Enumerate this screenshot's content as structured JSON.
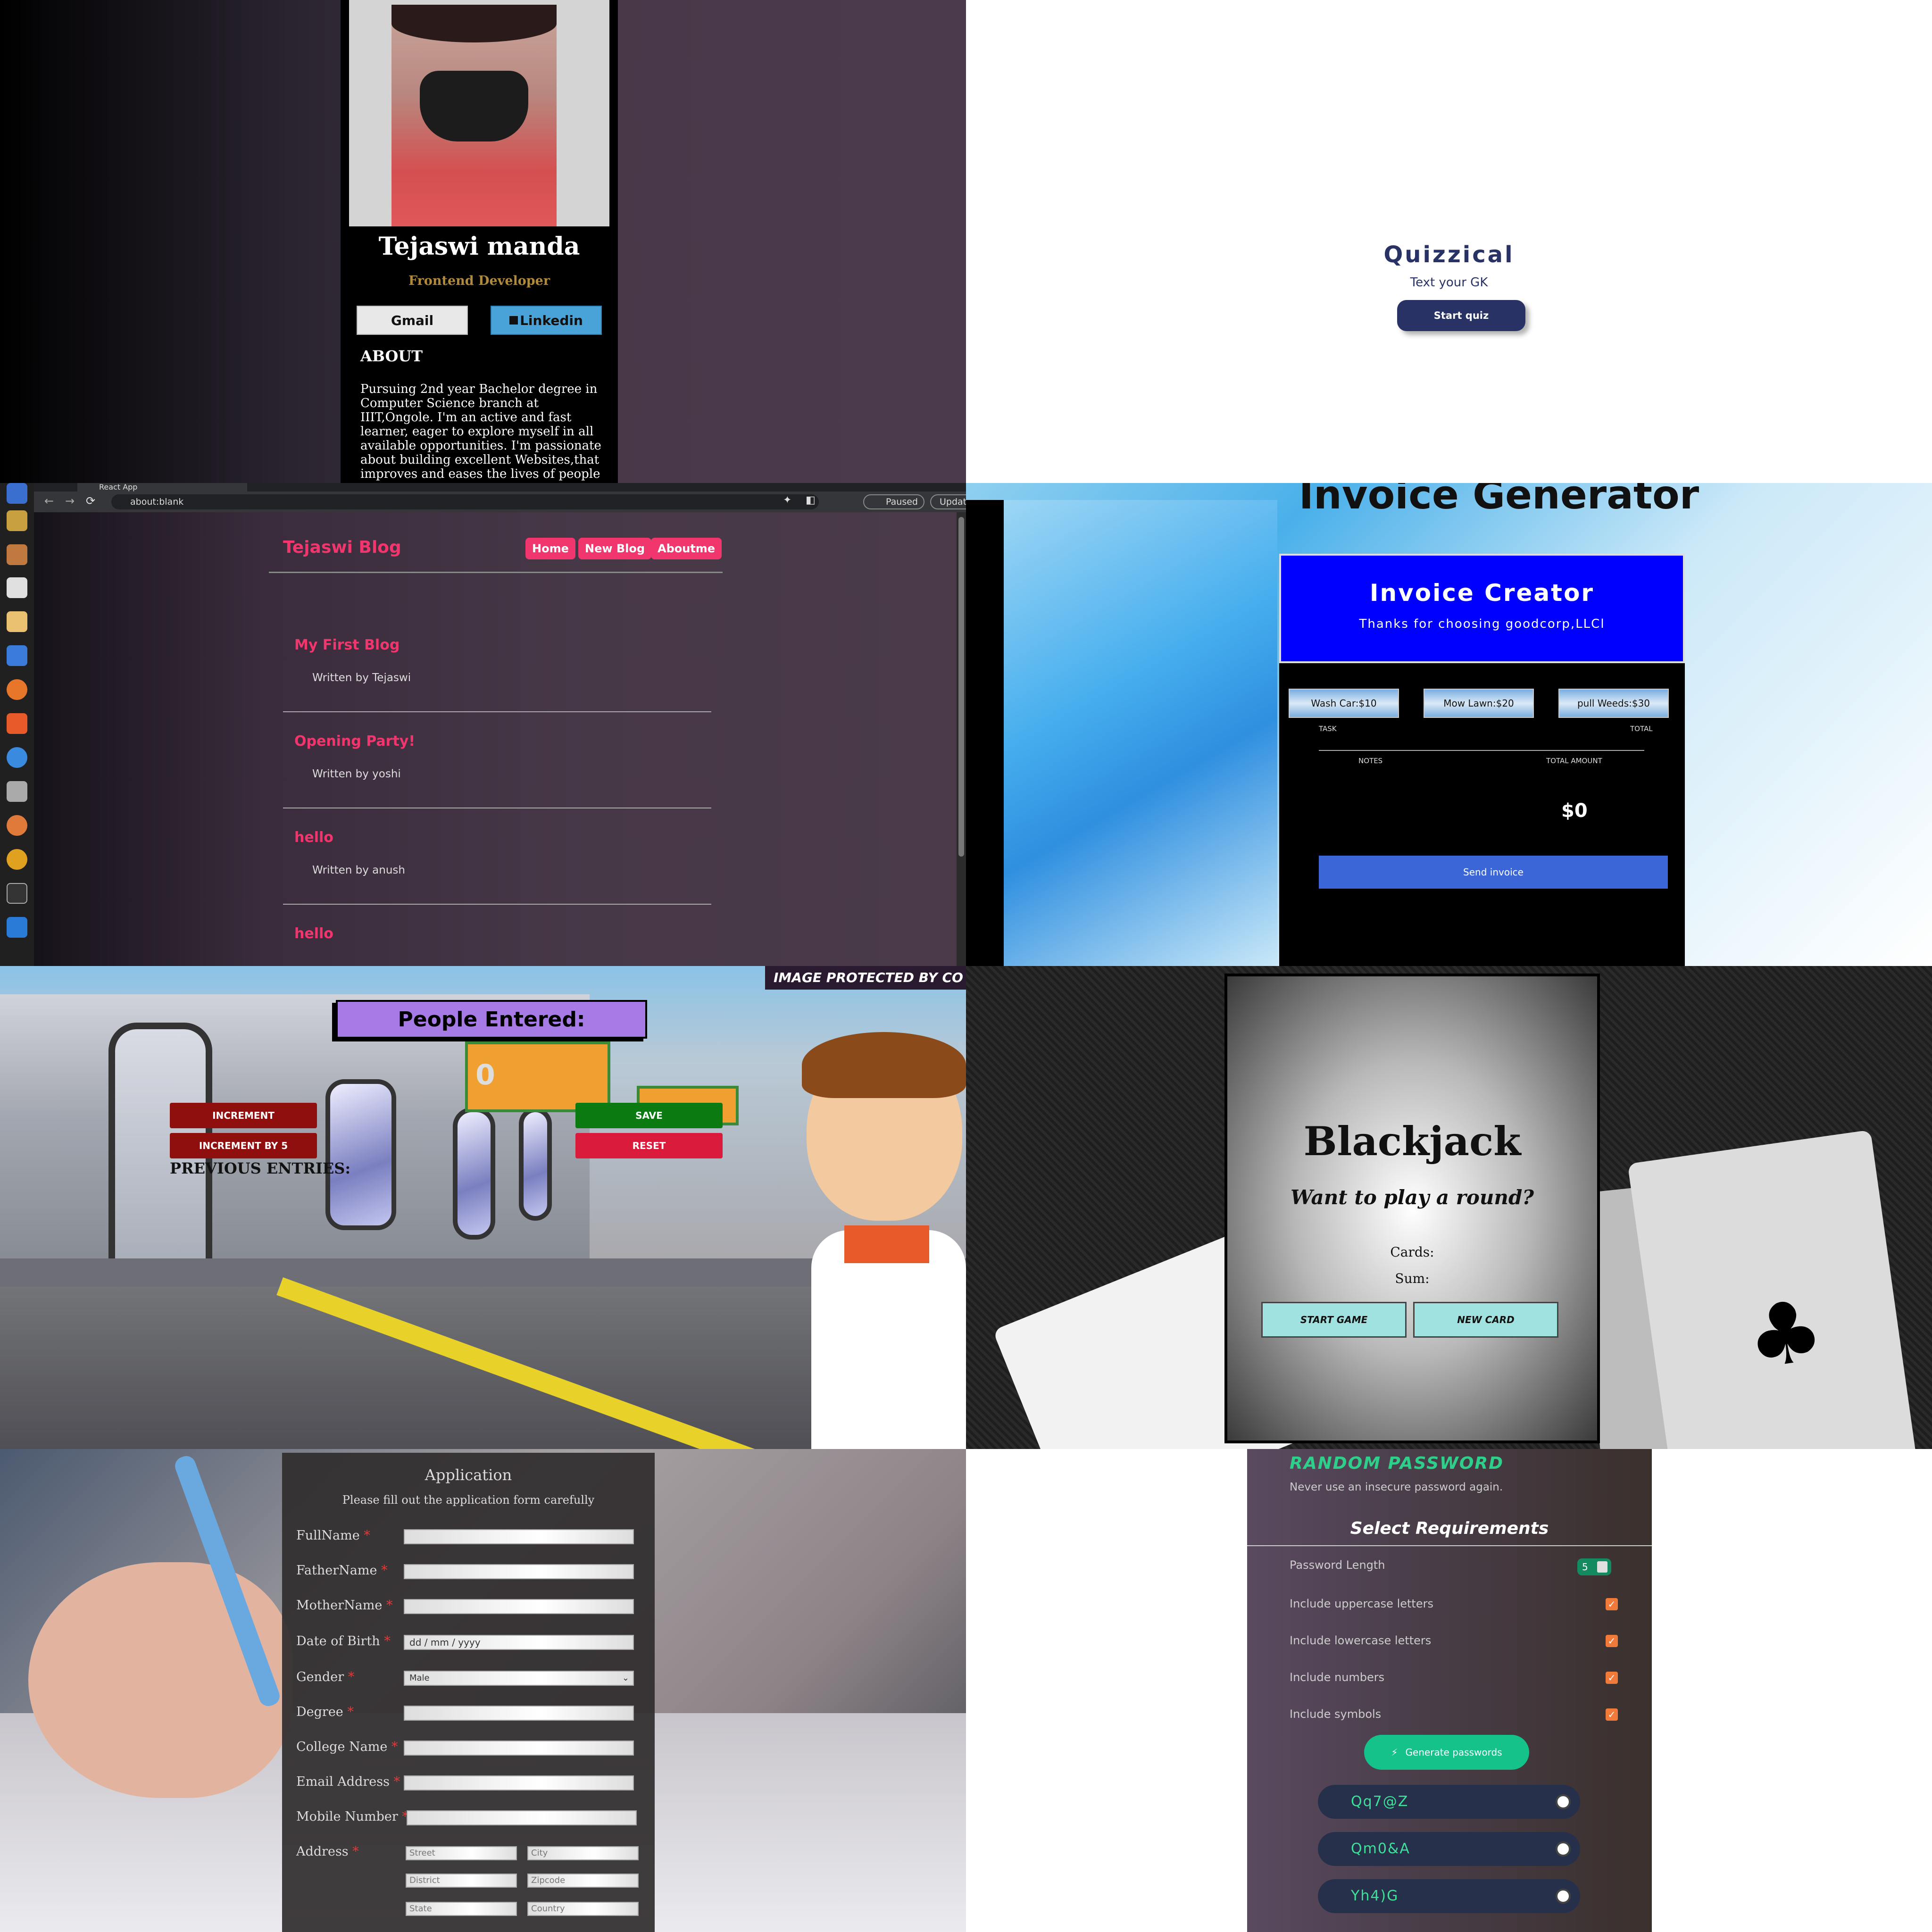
{
  "profile": {
    "name": "Tejaswi manda",
    "role": "Frontend Developer",
    "gmail": "Gmail",
    "linkedin": "Linkedin",
    "about_heading": "ABOUT",
    "about_text": "Pursuing 2nd year Bachelor degree in Computer Science branch at IIIT,Ongole. I'm an active and fast learner, eager to explore myself in all available opportunities. I'm passionate about building excellent Websites,that improves and eases the lives of people"
  },
  "quiz": {
    "title": "Quizzical",
    "subtitle": "Text your GK",
    "button": "Start quiz"
  },
  "browser": {
    "tab_title": "React App",
    "url": "about:blank",
    "paused": "Paused",
    "update": "Update"
  },
  "blog": {
    "logo": "Tejaswi Blog",
    "nav": [
      "Home",
      "New Blog",
      "Aboutme"
    ],
    "posts": [
      {
        "title": "My First Blog",
        "author": "Written by Tejaswi"
      },
      {
        "title": "Opening Party!",
        "author": "Written by yoshi"
      },
      {
        "title": "hello",
        "author": "Written by anush"
      },
      {
        "title": "hello",
        "author": ""
      }
    ]
  },
  "invoice": {
    "page_title": "Invoice Generator",
    "header": "Invoice Creator",
    "tagline": "Thanks for choosing goodcorp,LLCl",
    "tasks": [
      "Wash Car:$10",
      "Mow Lawn:$20",
      "pull Weeds:$30"
    ],
    "task_label": "TASK",
    "total_label": "TOTAL",
    "notes_label": "NOTES",
    "total_amount_label": "TOTAL AMOUNT",
    "total_value": "$0",
    "send": "Send invoice"
  },
  "counter": {
    "title": "People Entered:",
    "count": "0",
    "increment": "INCREMENT",
    "increment5": "INCREMENT BY 5",
    "save": "SAVE",
    "reset": "RESET",
    "previous": "PREVIOUS ENTRIES:",
    "watermark": "IMAGE PROTECTED BY CO"
  },
  "blackjack": {
    "title": "Blackjack",
    "subtitle": "Want to play a round?",
    "cards": "Cards:",
    "sum": "Sum:",
    "start": "START GAME",
    "new_card": "NEW CARD"
  },
  "application": {
    "title": "Application",
    "subtitle": "Please fill out the application form carefully",
    "fields": [
      "FullName",
      "FatherName",
      "MotherName",
      "Date of Birth",
      "Gender",
      "Degree",
      "College Name",
      "Email Address",
      "Mobile Number",
      "Address"
    ],
    "dob_placeholder": "dd / mm / yyyy",
    "gender_value": "Male",
    "address": {
      "street": "Street",
      "city": "City",
      "district": "District",
      "zipcode": "Zipcode",
      "state": "State",
      "country": "Country"
    }
  },
  "password": {
    "title": "RANDOM PASSWORD",
    "subtitle": "Never use an insecure password again.",
    "section": "Select Requirements",
    "length_label": "Password Length",
    "length_value": "5",
    "options": [
      "Include uppercase letters",
      "Include lowercase letters",
      "Include numbers",
      "Include symbols"
    ],
    "generate": "Generate passwords",
    "results": [
      "Qq7@Z",
      "Qm0&A",
      "Yh4)G"
    ]
  }
}
